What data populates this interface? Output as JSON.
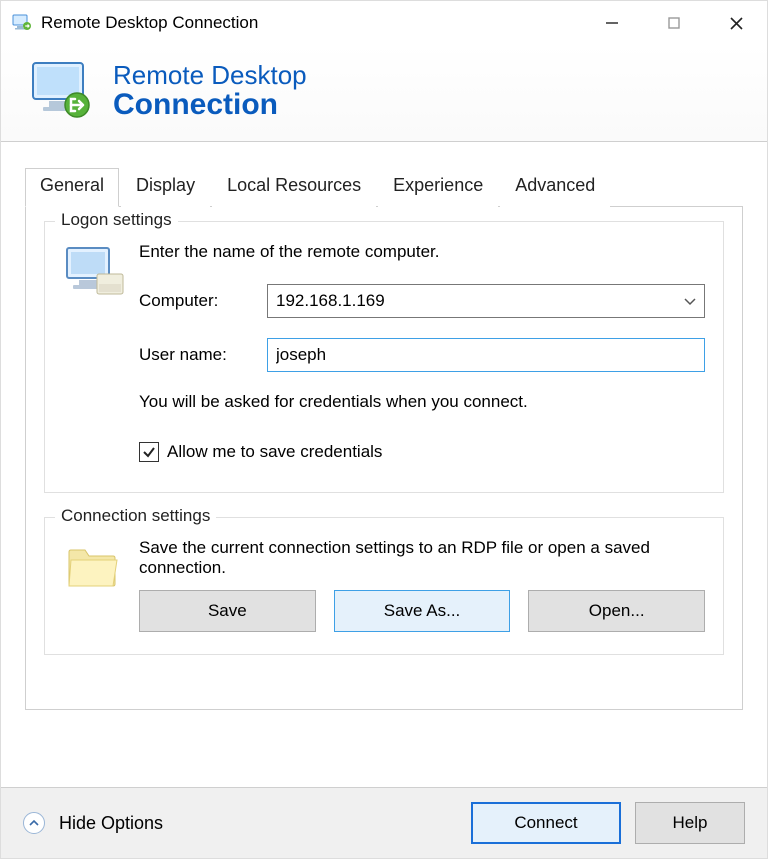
{
  "window": {
    "title": "Remote Desktop Connection"
  },
  "header": {
    "line1": "Remote Desktop",
    "line2": "Connection"
  },
  "tabs": {
    "items": [
      {
        "label": "General"
      },
      {
        "label": "Display"
      },
      {
        "label": "Local Resources"
      },
      {
        "label": "Experience"
      },
      {
        "label": "Advanced"
      }
    ],
    "active_index": 0
  },
  "logon": {
    "group_label": "Logon settings",
    "intro": "Enter the name of the remote computer.",
    "computer_label": "Computer:",
    "computer_value": "192.168.1.169",
    "username_label": "User name:",
    "username_value": "joseph",
    "info": "You will be asked for credentials when you connect.",
    "allow_save_label": "Allow me to save credentials",
    "allow_save_checked": true
  },
  "connection": {
    "group_label": "Connection settings",
    "intro": "Save the current connection settings to an RDP file or open a saved connection.",
    "save_label": "Save",
    "save_as_label": "Save As...",
    "open_label": "Open..."
  },
  "bottom": {
    "options_label": "Hide Options",
    "connect_label": "Connect",
    "help_label": "Help"
  }
}
